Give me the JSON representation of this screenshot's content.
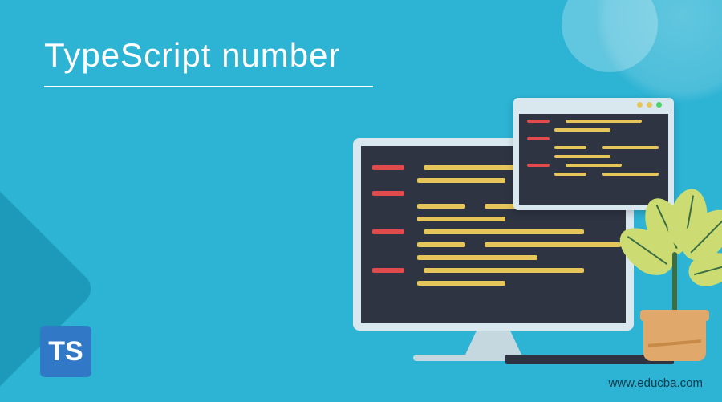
{
  "title": "TypeScript number",
  "logo_text": "TS",
  "url": "www.educba.com",
  "colors": {
    "background": "#2db3d4",
    "logo": "#3178c6",
    "code_bg": "#2f3443",
    "code_red": "#e24b4e",
    "code_yellow": "#e6c65a",
    "leaf": "#cddc72",
    "pot": "#e0a86a"
  }
}
